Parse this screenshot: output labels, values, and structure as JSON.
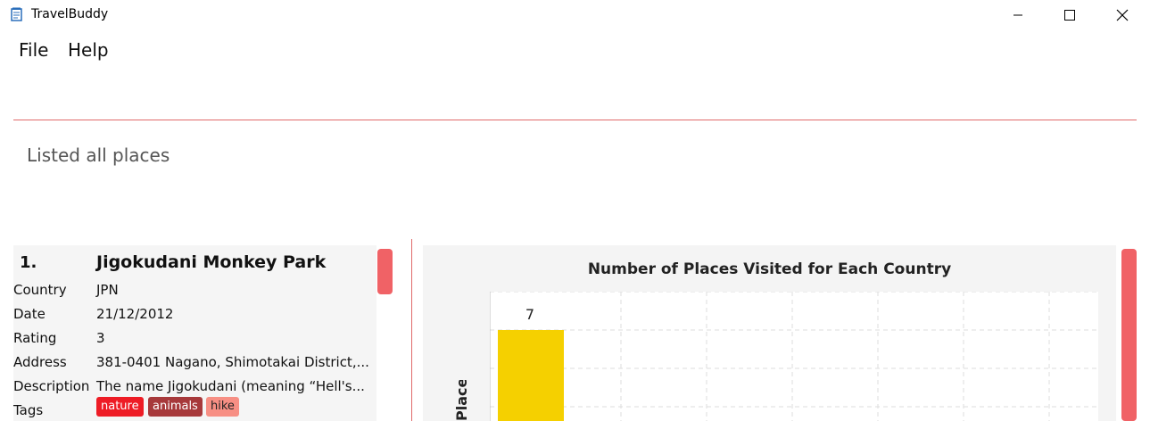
{
  "window": {
    "title": "TravelBuddy",
    "icon": "notepad-icon",
    "controls": [
      "minimize-icon",
      "maximize-icon",
      "close-icon"
    ]
  },
  "menu": {
    "file": "File",
    "help": "Help"
  },
  "status_message": "Listed all places",
  "place_card": {
    "index": "1.",
    "name": "Jigokudani Monkey Park",
    "fields": [
      {
        "label": "Country",
        "value": "JPN"
      },
      {
        "label": "Date",
        "value": "21/12/2012"
      },
      {
        "label": "Rating",
        "value": "3"
      },
      {
        "label": "Address",
        "value": "381-0401 Nagano, Shimotakai District,..."
      },
      {
        "label": "Description",
        "value": "The name Jigokudani (meaning “Hell's..."
      },
      {
        "label": "Tags",
        "value": ""
      }
    ],
    "tags": [
      {
        "name": "nature",
        "color": "#ee1c25",
        "text_color": "#ffffff"
      },
      {
        "name": "animals",
        "color": "#a7393b",
        "text_color": "#ffffff"
      },
      {
        "name": "hike",
        "color": "#f78f84",
        "text_color": "#222222"
      }
    ]
  },
  "colors": {
    "accent": "#e06a6a",
    "scrollbar": "#f06266",
    "bar": "#f5d000"
  },
  "chart_data": {
    "type": "bar",
    "title": "Number of Places Visited for Each Country",
    "ylabel": "Places",
    "categories": [
      ""
    ],
    "values": [
      7
    ],
    "data_labels": [
      "7"
    ],
    "grid": true
  }
}
